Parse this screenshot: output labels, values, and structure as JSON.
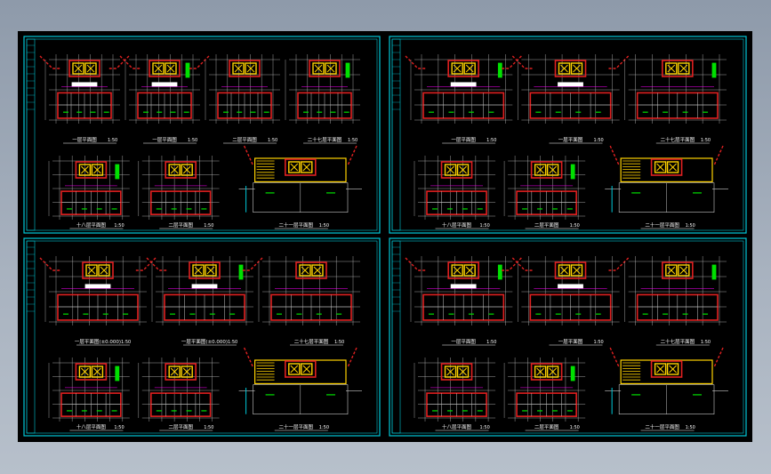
{
  "drawing": {
    "background": "#000000",
    "colors": {
      "frame": "#00c8d8",
      "wall": "#e02020",
      "elevator": "#ffd200",
      "grid": "#c8c8c8",
      "green": "#00e000",
      "magenta": "#ff00ff",
      "white": "#ffffff",
      "blue": "#4aa0ff"
    },
    "sheets": [
      {
        "id": "sheet-top-left",
        "row1": [
          {
            "label": "一层平面图",
            "scale": "1:50",
            "type": "lobby"
          },
          {
            "label": "一层平面图",
            "scale": "1:50",
            "type": "lobby"
          },
          {
            "label": "二层平面图",
            "scale": "1:50",
            "type": "floor"
          },
          {
            "label": "二十七层平面图",
            "scale": "1:50",
            "type": "floor"
          }
        ],
        "row2": [
          {
            "label": "十八层平面图",
            "scale": "1:50",
            "type": "floor"
          },
          {
            "label": "二层平面图",
            "scale": "1:50",
            "type": "floor"
          },
          {
            "label": "二十一层平面图",
            "scale": "1:50",
            "type": "stair"
          }
        ]
      },
      {
        "id": "sheet-top-right",
        "row1": [
          {
            "label": "一层平面图",
            "scale": "1:50",
            "type": "lobby"
          },
          {
            "label": "一层平面图",
            "scale": "1:50",
            "type": "lobby"
          },
          {
            "label": "二十七层平面图",
            "scale": "1:50",
            "type": "floor"
          }
        ],
        "row2": [
          {
            "label": "十八层平面图",
            "scale": "1:50",
            "type": "floor"
          },
          {
            "label": "二层平面图",
            "scale": "1:50",
            "type": "floor"
          },
          {
            "label": "二十一层平面图",
            "scale": "1:50",
            "type": "stair"
          }
        ]
      },
      {
        "id": "sheet-bottom-left",
        "row1": [
          {
            "label": "一层平面图(±0.000)",
            "scale": "1:50",
            "type": "lobby"
          },
          {
            "label": "一层平面图(±0.000)",
            "scale": "1:50",
            "type": "lobby"
          },
          {
            "label": "二十七层平面图",
            "scale": "1:50",
            "type": "floor"
          }
        ],
        "row2": [
          {
            "label": "十八层平面图",
            "scale": "1:50",
            "type": "floor"
          },
          {
            "label": "二层平面图",
            "scale": "1:50",
            "type": "floor"
          },
          {
            "label": "二十一层平面图",
            "scale": "1:50",
            "type": "stair"
          }
        ]
      },
      {
        "id": "sheet-bottom-right",
        "row1": [
          {
            "label": "一层平面图",
            "scale": "1:50",
            "type": "lobby"
          },
          {
            "label": "一层平面图",
            "scale": "1:50",
            "type": "lobby"
          },
          {
            "label": "二十七层平面图",
            "scale": "1:50",
            "type": "floor"
          }
        ],
        "row2": [
          {
            "label": "十八层平面图",
            "scale": "1:50",
            "type": "floor"
          },
          {
            "label": "二层平面图",
            "scale": "1:50",
            "type": "floor"
          },
          {
            "label": "二十一层平面图",
            "scale": "1:50",
            "type": "stair"
          }
        ]
      }
    ]
  }
}
